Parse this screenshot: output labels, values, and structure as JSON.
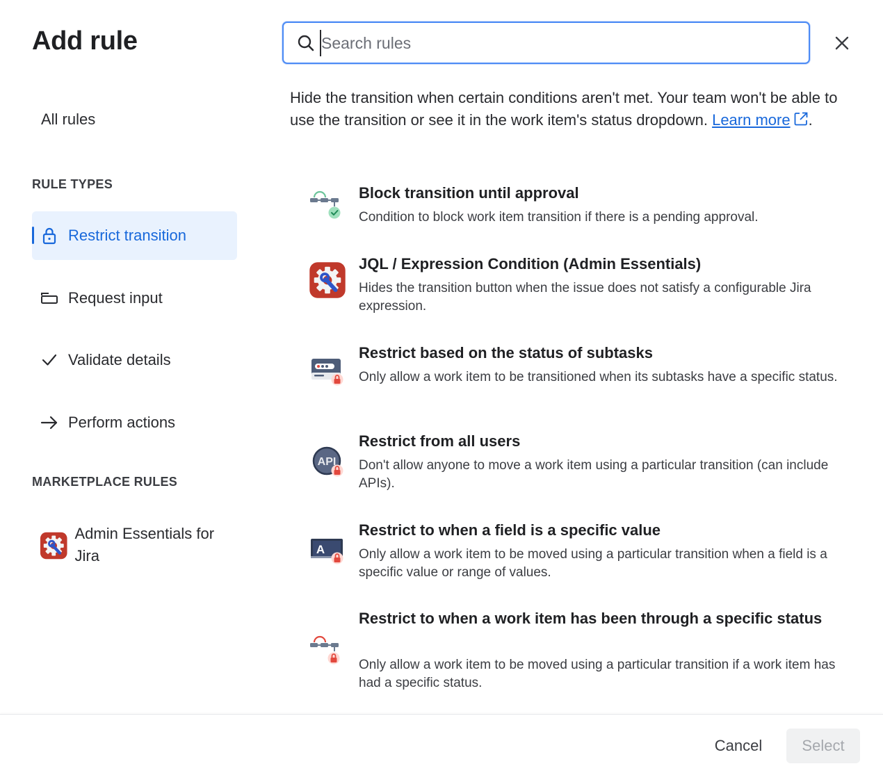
{
  "dialog": {
    "title": "Add rule",
    "close_icon": "close-icon"
  },
  "search": {
    "placeholder": "Search rules",
    "value": "",
    "icon": "search-icon"
  },
  "sidebar": {
    "all_rules_label": "All rules",
    "rule_types_heading": "RULE TYPES",
    "items": [
      {
        "label": "Restrict transition",
        "icon": "lock-icon",
        "selected": true
      },
      {
        "label": "Request input",
        "icon": "input-field-icon",
        "selected": false
      },
      {
        "label": "Validate details",
        "icon": "checkmark-icon",
        "selected": false
      },
      {
        "label": "Perform actions",
        "icon": "arrow-right-icon",
        "selected": false
      }
    ],
    "marketplace_heading": "MARKETPLACE RULES",
    "marketplace_items": [
      {
        "label": "Admin Essentials for Jira",
        "icon": "admin-essentials-gear-icon"
      }
    ]
  },
  "main": {
    "description": "Hide the transition when certain conditions aren't met. Your team won't be able to use the transition or see it in the work item's status dropdown.",
    "learn_more_label": "Learn more",
    "rules": [
      {
        "title": "Block transition until approval",
        "description": "Condition to block work item transition if there is a pending approval.",
        "icon": "approval-flow-icon"
      },
      {
        "title": "JQL / Expression Condition (Admin Essentials)",
        "description": "Hides the transition button when the issue does not satisfy a configurable Jira expression.",
        "icon": "admin-essentials-gear-icon"
      },
      {
        "title": "Restrict based on the status of subtasks",
        "description": "Only allow a work item to be transitioned when its subtasks have a specific status.",
        "icon": "subtasks-lock-icon"
      },
      {
        "title": "Restrict from all users",
        "description": "Don't allow anyone to move a work item using a particular transition (can include APIs).",
        "icon": "api-lock-icon",
        "icon_text": "API"
      },
      {
        "title": "Restrict to when a field is a specific value",
        "description": "Only allow a work item to be moved using a particular transition when a field is a specific value or range of values.",
        "icon": "field-value-lock-icon",
        "icon_text": "A"
      },
      {
        "title": "Restrict to when a work item has been through a specific status",
        "description": "Only allow a work item to be moved using a particular transition if a work item has had a specific status.",
        "icon": "status-flow-lock-icon"
      }
    ]
  },
  "footer": {
    "cancel_label": "Cancel",
    "select_label": "Select"
  },
  "colors": {
    "accent": "#1868db",
    "selected_bg": "#e9f2fe",
    "lock_red": "#e2483d",
    "approval_green": "#6cc59b",
    "admin_red": "#c0392b"
  }
}
